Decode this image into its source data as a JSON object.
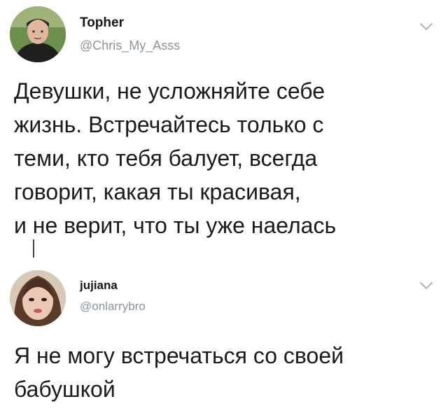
{
  "tweets": [
    {
      "display_name": "Topher",
      "handle": "@Chris_My_Asss",
      "text": "Девушки, не усложняйте себе\nжизнь. Встречайтесь только с\nтеми, кто тебя балует, всегда\nговорит, какая ты красивая,\nи не верит, что ты уже наелась",
      "avatar_icon": "user-photo-avatar",
      "menu_icon": "chevron-down-icon"
    },
    {
      "display_name": "jujiana",
      "handle": "@onlarrybro",
      "text": "Я не могу встречаться со своей\nбабушкой",
      "avatar_icon": "user-photo-avatar",
      "menu_icon": "chevron-down-icon"
    }
  ],
  "colors": {
    "name": "#14171a",
    "handle": "#8a949e",
    "text": "#1a1a1a",
    "chevron": "#aab8c2"
  }
}
